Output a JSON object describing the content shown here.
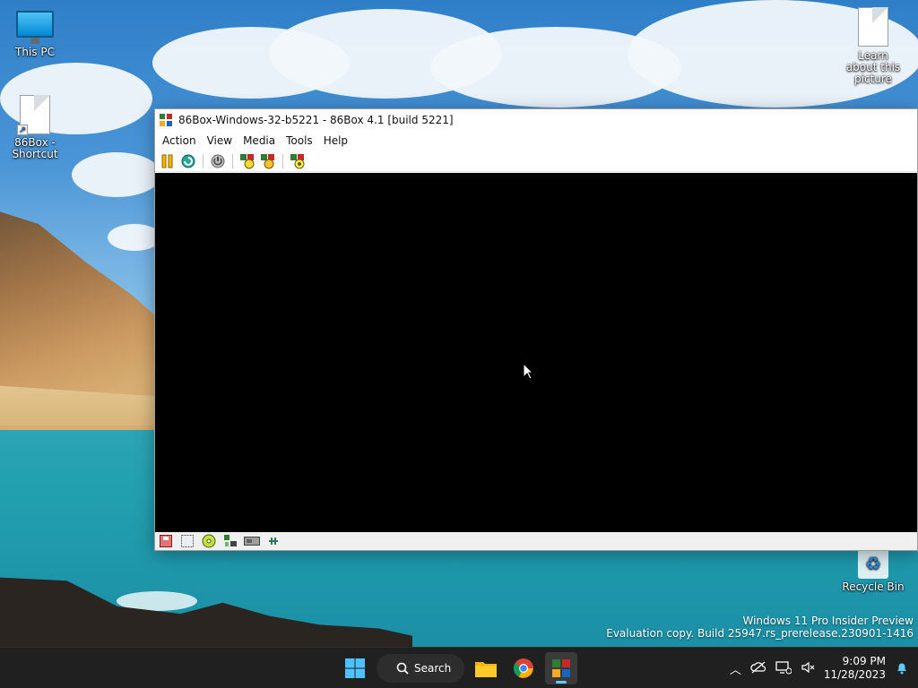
{
  "desktop": {
    "icons": [
      {
        "label": "This PC"
      },
      {
        "label": "86Box - Shortcut"
      },
      {
        "label": "Learn about this picture"
      },
      {
        "label": "Recycle Bin"
      }
    ],
    "watermark": {
      "line1": "Windows 11 Pro Insider Preview",
      "line2": "Evaluation copy. Build 25947.rs_prerelease.230901-1416"
    }
  },
  "window": {
    "title": "86Box-Windows-32-b5221 - 86Box 4.1 [build 5221]",
    "menu": [
      "Action",
      "View",
      "Media",
      "Tools",
      "Help"
    ],
    "toolbar_icons": [
      "pause-icon",
      "reset-icon",
      "power-icon",
      "settings-icon",
      "hard-reset-icon",
      "ctrl-alt-del-icon"
    ],
    "status_icons": [
      "floppy-icon",
      "hdd-icon",
      "cdrom-icon",
      "network-icon",
      "sound-icon",
      "keyboard-icon"
    ],
    "screen_color": "#000000"
  },
  "taskbar": {
    "search_label": "Search",
    "time": "9:09 PM",
    "date": "11/28/2023",
    "accent": "#60cdff"
  }
}
